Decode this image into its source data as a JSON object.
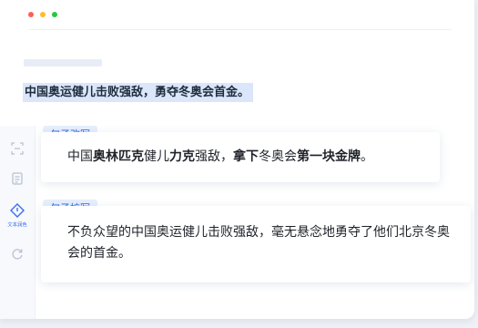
{
  "colors": {
    "accent": "#2a6bf2",
    "highlight": "#dce6fa",
    "tag_bg": "#e6effd"
  },
  "source_text": "中国奥运健儿击败强敌，勇夺冬奥会首金。",
  "sidebar": {
    "items": [
      {
        "icon": "scan-icon",
        "label": "",
        "active": false
      },
      {
        "icon": "document-icon",
        "label": "",
        "active": false
      },
      {
        "icon": "text-polish-icon",
        "label": "文本润色",
        "active": true
      },
      {
        "icon": "refresh-icon",
        "label": "",
        "active": false
      }
    ]
  },
  "rewrite": {
    "tag": "句子改写",
    "segments": [
      {
        "text": "中国",
        "bold": false
      },
      {
        "text": "奥林匹克",
        "bold": true
      },
      {
        "text": "健儿",
        "bold": false
      },
      {
        "text": "力克",
        "bold": true
      },
      {
        "text": "强敌，",
        "bold": false
      },
      {
        "text": "拿下",
        "bold": true
      },
      {
        "text": "冬奥会",
        "bold": false
      },
      {
        "text": "第一块金牌",
        "bold": true
      },
      {
        "text": "。",
        "bold": false
      }
    ]
  },
  "expand": {
    "tag": "句子扩写",
    "text": "不负众望的中国奥运健儿击败强敌，毫无悬念地勇夺了他们北京冬奥会的首金。"
  }
}
